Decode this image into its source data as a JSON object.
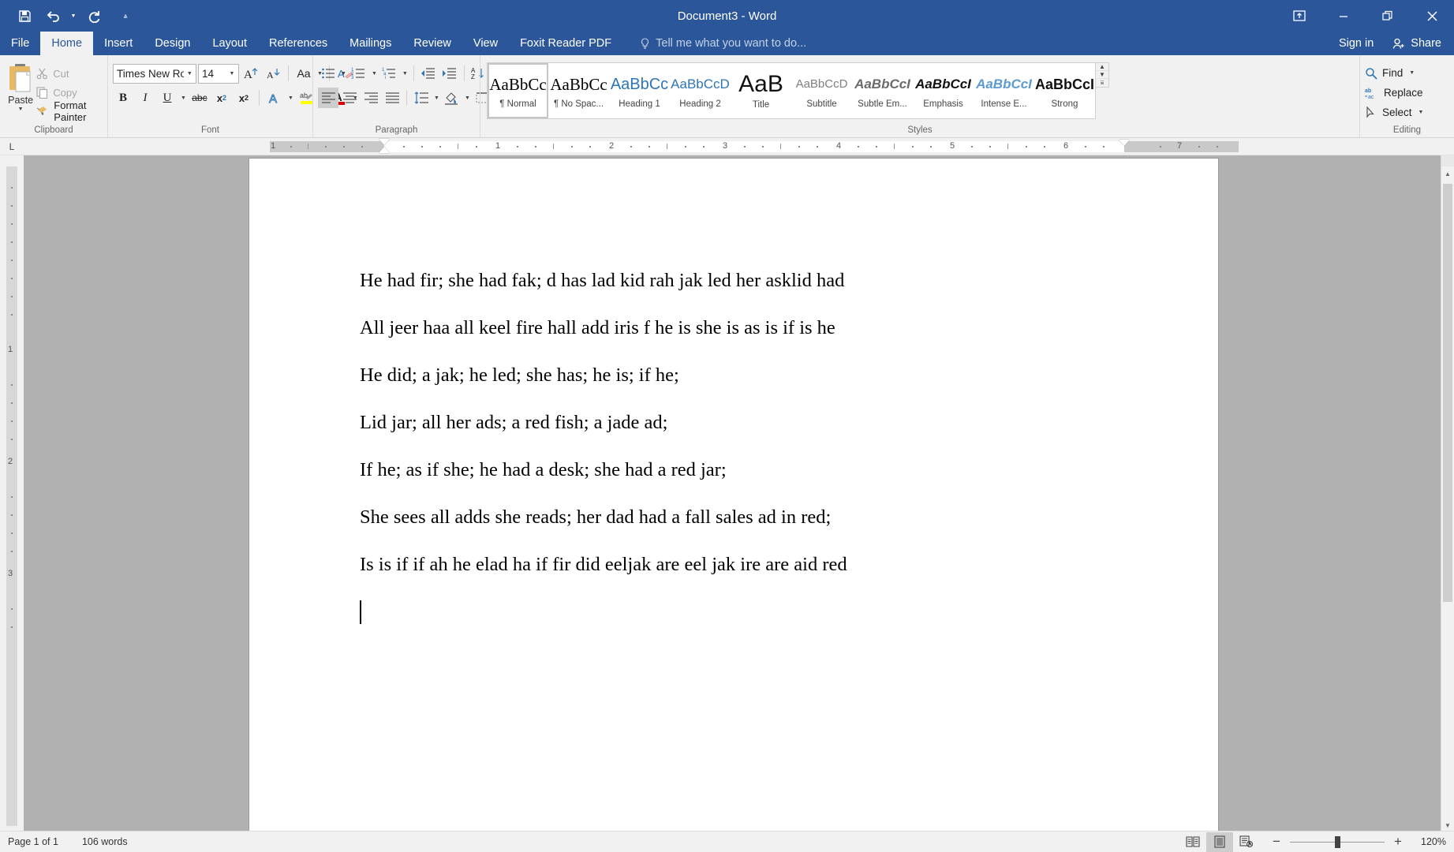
{
  "window": {
    "title": "Document3 - Word",
    "quick_access": [
      "save-icon",
      "undo-icon",
      "redo-icon",
      "customize-qat-icon"
    ],
    "controls": {
      "ribbon_display_options": "ribbon-display-options-icon",
      "minimize": "minimize-icon",
      "restore": "restore-icon",
      "close": "close-icon"
    }
  },
  "tabs": [
    {
      "label": "File",
      "active": false
    },
    {
      "label": "Home",
      "active": true
    },
    {
      "label": "Insert",
      "active": false
    },
    {
      "label": "Design",
      "active": false
    },
    {
      "label": "Layout",
      "active": false
    },
    {
      "label": "References",
      "active": false
    },
    {
      "label": "Mailings",
      "active": false
    },
    {
      "label": "Review",
      "active": false
    },
    {
      "label": "View",
      "active": false
    },
    {
      "label": "Foxit Reader PDF",
      "active": false
    }
  ],
  "tellme": {
    "placeholder": "Tell me what you want to do..."
  },
  "account": {
    "signin": "Sign in",
    "share": "Share"
  },
  "ribbon": {
    "clipboard": {
      "group_label": "Clipboard",
      "paste": "Paste",
      "cut": "Cut",
      "copy": "Copy",
      "format_painter": "Format Painter"
    },
    "font": {
      "group_label": "Font",
      "font_name": "Times New Ro",
      "font_size": "14",
      "buttons": [
        "grow-font",
        "shrink-font",
        "change-case",
        "clear-formatting",
        "bold",
        "italic",
        "underline",
        "strikethrough",
        "subscript",
        "superscript",
        "text-effects",
        "text-highlight",
        "font-color"
      ]
    },
    "paragraph": {
      "group_label": "Paragraph",
      "buttons": [
        "bullets",
        "numbering",
        "multilevel-list",
        "decrease-indent",
        "increase-indent",
        "sort",
        "show-formatting-marks",
        "align-left",
        "align-center",
        "align-right",
        "justify",
        "line-spacing",
        "shading",
        "borders"
      ],
      "active_alignment": "align-left"
    },
    "styles": {
      "group_label": "Styles",
      "items": [
        {
          "preview": "AaBbCc",
          "name": "¶ Normal",
          "selected": true,
          "style": "serif-black"
        },
        {
          "preview": "AaBbCc",
          "name": "¶ No Spac...",
          "selected": false,
          "style": "serif-black"
        },
        {
          "preview": "AaBbCc",
          "name": "Heading 1",
          "selected": false,
          "style": "sans-blue"
        },
        {
          "preview": "AaBbCcD",
          "name": "Heading 2",
          "selected": false,
          "style": "sans-blue-sm"
        },
        {
          "preview": "AaB",
          "name": "Title",
          "selected": false,
          "style": "title-big"
        },
        {
          "preview": "AaBbCcD",
          "name": "Subtitle",
          "selected": false,
          "style": "serif-gray"
        },
        {
          "preview": "AaBbCcI",
          "name": "Subtle Em...",
          "selected": false,
          "style": "sans-italic-gray"
        },
        {
          "preview": "AaBbCcI",
          "name": "Emphasis",
          "selected": false,
          "style": "sans-italic-black"
        },
        {
          "preview": "AaBbCcI",
          "name": "Intense E...",
          "selected": false,
          "style": "sans-italic-blue"
        },
        {
          "preview": "AaBbCcI",
          "name": "Strong",
          "selected": false,
          "style": "sans-bold-black"
        }
      ]
    },
    "editing": {
      "group_label": "Editing",
      "find": "Find",
      "replace": "Replace",
      "select": "Select"
    }
  },
  "ruler": {
    "horizontal_marks": [
      "1",
      "1",
      "2",
      "3",
      "4",
      "5",
      "6",
      "7"
    ],
    "vertical_marks": [
      "1",
      "2",
      "3"
    ]
  },
  "document": {
    "lines": [
      "He had fir; she had fak; d has lad kid rah jak led her asklid had",
      "All jeer haa all keel fire hall add iris f he is she is as is if is he",
      "He did; a jak; he led; she has; he is; if he;",
      "Lid jar; all her ads; a red fish; a jade ad;",
      "If he; as if she; he had a desk; she had a red jar;",
      "She sees all adds she reads; her dad had a fall sales ad in red;",
      "Is is if if ah he elad ha if fir did eeljak are eel jak ire are aid red"
    ]
  },
  "status": {
    "page": "Page 1 of 1",
    "words": "106 words",
    "views": [
      "read-mode-icon",
      "print-layout-icon",
      "web-layout-icon"
    ],
    "active_view": "print-layout-icon",
    "zoom_out": "−",
    "zoom_in": "+",
    "zoom_level": "120%"
  },
  "colors": {
    "brand": "#2b579a",
    "ribbon_bg": "#f1f1f1",
    "workspace_bg": "#b1b1b1",
    "accent_blue": "#2e75b6"
  }
}
